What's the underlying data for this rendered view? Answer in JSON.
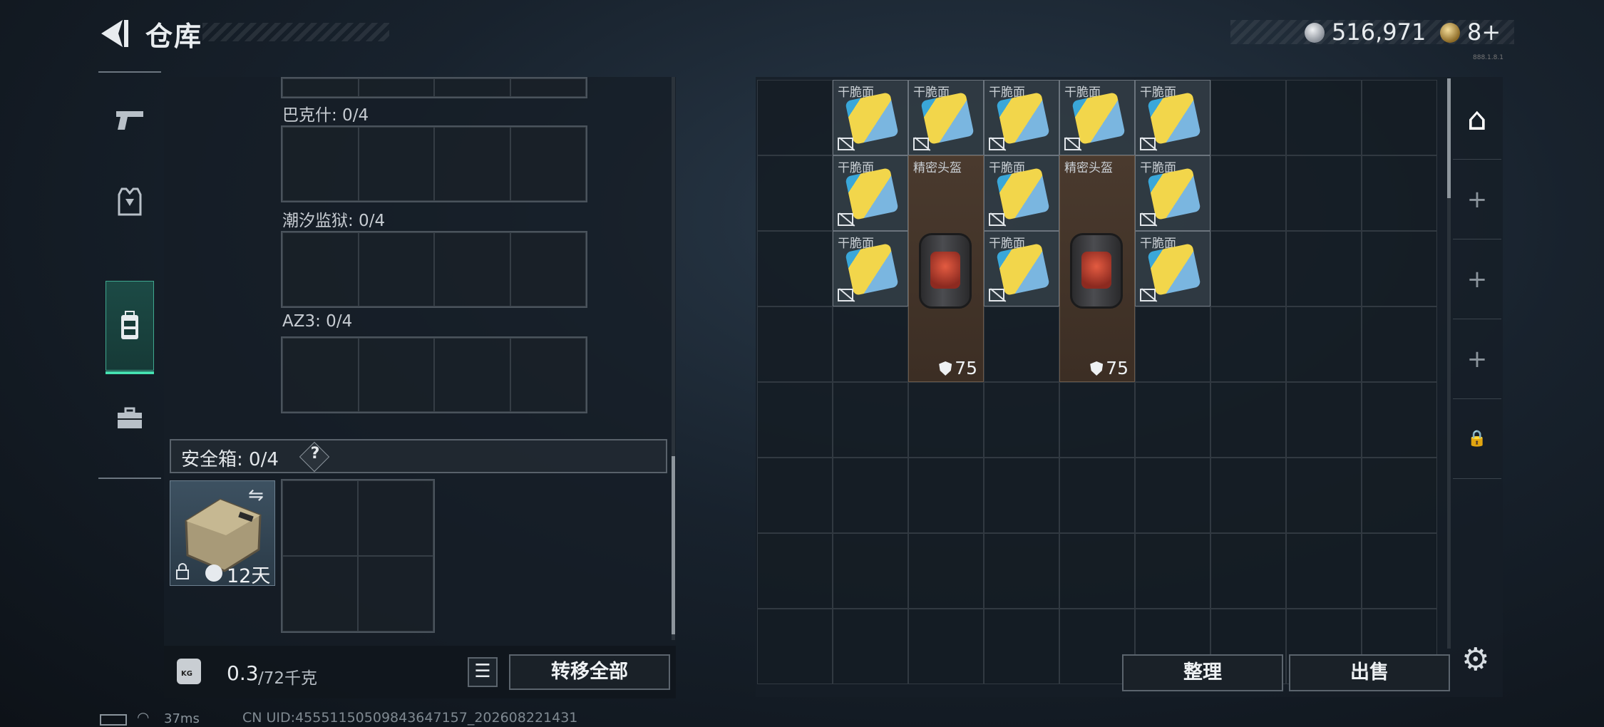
{
  "header": {
    "title": "仓库",
    "currency": "516,971",
    "medals": "8+",
    "tiny_note": "888.1.8.1"
  },
  "colors": {
    "accent": "#45e0b0",
    "helmet_bg": "#3c2e24"
  },
  "sidebar": {
    "tabs": [
      {
        "icon": "pistol-icon",
        "glyph": "⌐"
      },
      {
        "icon": "armor-vest-icon",
        "glyph": "⛨"
      },
      {
        "icon": "backpack-icon",
        "glyph": "▤",
        "active": true
      },
      {
        "icon": "toolbox-icon",
        "glyph": "⌸"
      }
    ]
  },
  "containers": [
    {
      "label": "巴克什: 0/4"
    },
    {
      "label": "潮汐监狱: 0/4"
    },
    {
      "label": "AZ3: 0/4"
    }
  ],
  "safe_box": {
    "label": "安全箱: 0/4",
    "help": "?",
    "swap_icon": "⇋",
    "lock_icon": "🔒",
    "duration": "12天"
  },
  "footer_left": {
    "weight_icon_label": "KG",
    "weight_value": "0.3",
    "weight_unit": "/72千克",
    "list_icon": "☰",
    "transfer_all": "转移全部"
  },
  "status": {
    "ping": "37ms",
    "uid": "CN UID:45551150509843647157_202608221431"
  },
  "storage": {
    "columns": 9,
    "rows": 8,
    "items": [
      {
        "name": "干脆面",
        "type": "noodles",
        "col": 1,
        "row": 0,
        "h": 1
      },
      {
        "name": "干脆面",
        "type": "noodles",
        "col": 2,
        "row": 0,
        "h": 1
      },
      {
        "name": "干脆面",
        "type": "noodles",
        "col": 3,
        "row": 0,
        "h": 1
      },
      {
        "name": "干脆面",
        "type": "noodles",
        "col": 4,
        "row": 0,
        "h": 1
      },
      {
        "name": "干脆面",
        "type": "noodles",
        "col": 5,
        "row": 0,
        "h": 1
      },
      {
        "name": "干脆面",
        "type": "noodles",
        "col": 1,
        "row": 1,
        "h": 1
      },
      {
        "name": "精密头盔",
        "type": "helmet",
        "col": 2,
        "row": 1,
        "h": 3,
        "armor": "75"
      },
      {
        "name": "干脆面",
        "type": "noodles",
        "col": 3,
        "row": 1,
        "h": 1
      },
      {
        "name": "精密头盔",
        "type": "helmet",
        "col": 4,
        "row": 1,
        "h": 3,
        "armor": "75"
      },
      {
        "name": "干脆面",
        "type": "noodles",
        "col": 5,
        "row": 1,
        "h": 1
      },
      {
        "name": "干脆面",
        "type": "noodles",
        "col": 1,
        "row": 2,
        "h": 1
      },
      {
        "name": "干脆面",
        "type": "noodles",
        "col": 3,
        "row": 2,
        "h": 1
      },
      {
        "name": "干脆面",
        "type": "noodles",
        "col": 5,
        "row": 2,
        "h": 1
      }
    ]
  },
  "right_tabs": [
    {
      "icon": "warehouse-icon",
      "glyph": "⌂"
    },
    {
      "icon": "add-icon",
      "glyph": "+"
    },
    {
      "icon": "add-icon",
      "glyph": "+"
    },
    {
      "icon": "add-icon",
      "glyph": "+"
    },
    {
      "icon": "lock-icon",
      "glyph": "🔒"
    }
  ],
  "footer_right": {
    "sort": "整理",
    "sell": "出售",
    "settings_icon": "⚙"
  }
}
